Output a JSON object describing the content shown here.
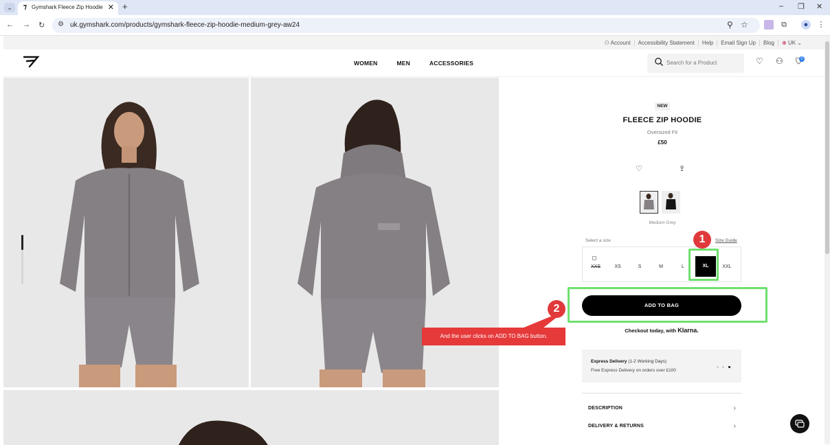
{
  "browser": {
    "tab_title": "Gymshark Fleece Zip Hoodie - ",
    "url": "uk.gymshark.com/products/gymshark-fleece-zip-hoodie-medium-grey-aw24"
  },
  "utility_bar": {
    "links": [
      "Account",
      "Accessibility Statement",
      "Help",
      "Email Sign Up",
      "Blog",
      "UK"
    ]
  },
  "header": {
    "nav": [
      "WOMEN",
      "MEN",
      "ACCESSORIES"
    ],
    "search_placeholder": "Search for a Product",
    "bag_count": "0"
  },
  "product": {
    "badge": "NEW",
    "title": "FLEECE ZIP HOODIE",
    "fit": "Oversized Fit",
    "price": "£50",
    "colour": "Medium Grey",
    "select_size_label": "Select a size",
    "size_guide": "Size Guide",
    "sizes": [
      "XXS",
      "XS",
      "S",
      "M",
      "L",
      "XL",
      "XXL"
    ],
    "selected_size": "XL",
    "add_to_bag": "ADD TO BAG",
    "klarna_text": "Checkout today, with",
    "klarna_brand": "Klarna.",
    "delivery_title": "Express Delivery",
    "delivery_days": "(1-2 Working Days)",
    "delivery_sub": "Free Express Delivery on orders over £100",
    "accordion": [
      "DESCRIPTION",
      "DELIVERY & RETURNS"
    ]
  },
  "annotations": {
    "step1": "1",
    "step2": "2",
    "callout": "And the user clicks on ADD TO BAG button."
  },
  "colors": {
    "highlight": "#6ee06e",
    "annotation_red": "#e5393a",
    "cta": "#000000",
    "bag_badge": "#2b7de9"
  }
}
